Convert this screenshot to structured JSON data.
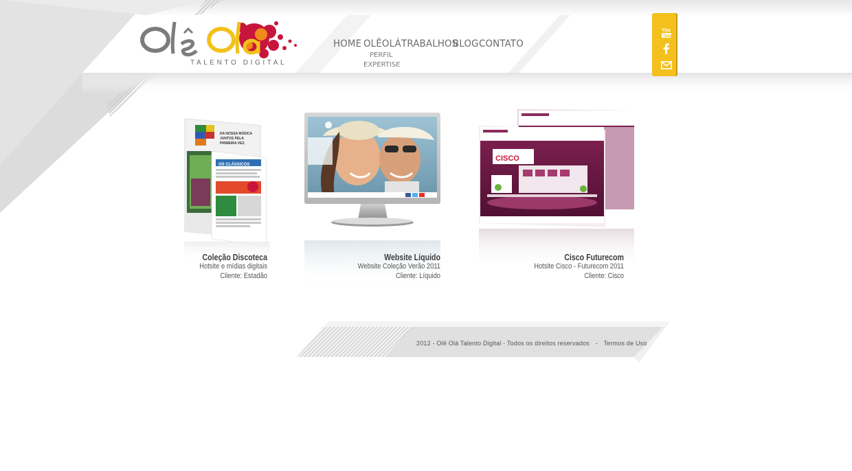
{
  "brand": {
    "logo_text": "Olê Olá",
    "tagline": "TALENTO DIGITAL",
    "colors": {
      "accent_yellow": "#f3c01c",
      "logo_gray": "#7a7a7a",
      "splash_red": "#c8153c"
    }
  },
  "nav": {
    "items": [
      {
        "label": "HOME",
        "icon": ""
      },
      {
        "label": "OLÊOLÁ",
        "icon": ""
      },
      {
        "label": "TRABALHOS",
        "icon": ""
      },
      {
        "label": "BLOG",
        "icon": ""
      },
      {
        "label": "CONTATO",
        "icon": ""
      }
    ],
    "sub_items": [
      {
        "label": "PERFIL"
      },
      {
        "label": "EXPERTISE"
      }
    ]
  },
  "social": {
    "items": [
      {
        "icon": "youtube-icon"
      },
      {
        "icon": "facebook-icon"
      },
      {
        "icon": "mail-icon"
      }
    ]
  },
  "portfolio": [
    {
      "title": "Coleção Discoteca",
      "line1": "Hotsite e mídias digitais",
      "line2": "Cliente: Estadão",
      "thumb_text": [
        "OS CLÁSSICOS",
        "DA NOSSA MÚSICA",
        "JUNTOS PELA",
        "PRIMEIRA VEZ."
      ]
    },
    {
      "title": "Website Líquido",
      "line1": "Website Coleção Verão 2011",
      "line2": "Cliente: Líquido"
    },
    {
      "title": "Cisco Futurecom",
      "line1": "Hotsite Cisco - Futurecom 2011",
      "line2": "Cliente: Cisco",
      "thumb_text": [
        "CISCO"
      ]
    }
  ],
  "footer": {
    "copyright": "2012 - Olê Olá Talento Digital - Todos os direitos reservados",
    "separator": "-",
    "terms": "Termos de Uso"
  }
}
